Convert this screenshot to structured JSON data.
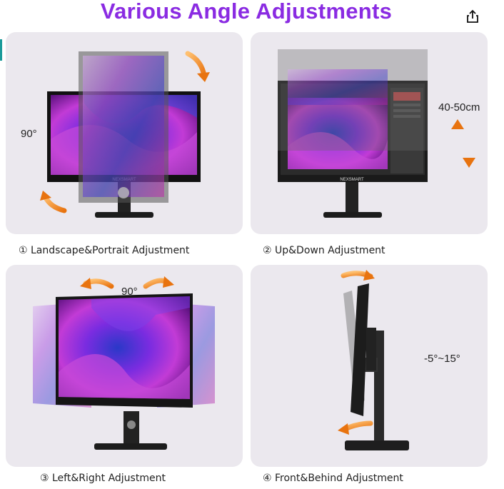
{
  "header": {
    "title": "Various Angle Adjustments",
    "share_icon": "share-icon"
  },
  "brand": "NEXSMART",
  "panels": [
    {
      "caption": "① Landscape&Portrait Adjustment",
      "label": "90°"
    },
    {
      "caption": "② Up&Down Adjustment",
      "label": "40-50cm"
    },
    {
      "caption": "③ Left&Right Adjustment",
      "label": "90°"
    },
    {
      "caption": "④ Front&Behind Adjustment",
      "label": "-5°~15°"
    }
  ],
  "colors": {
    "title": "#8a2be2",
    "panel_bg": "#ebe8ee",
    "arrow": "#f08a1e",
    "screen_purple": "#a020c8",
    "screen_blue": "#3050e0"
  }
}
